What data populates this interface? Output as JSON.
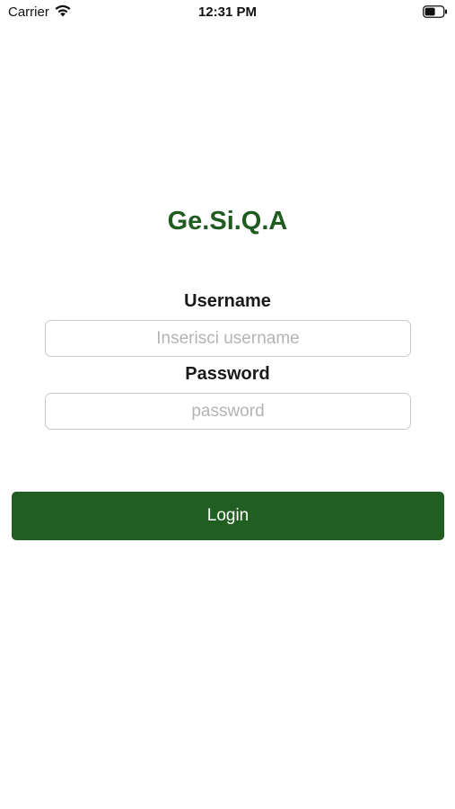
{
  "status_bar": {
    "carrier": "Carrier",
    "time": "12:31 PM",
    "wifi_icon": "wifi-icon",
    "battery_icon": "battery-icon"
  },
  "app": {
    "title": "Ge.Si.Q.A",
    "brand_color": "#1f5c20"
  },
  "form": {
    "username_label": "Username",
    "username_placeholder": "Inserisci username",
    "username_value": "",
    "password_label": "Password",
    "password_placeholder": "password",
    "password_value": "",
    "login_label": "Login",
    "button_color": "#215e21"
  }
}
